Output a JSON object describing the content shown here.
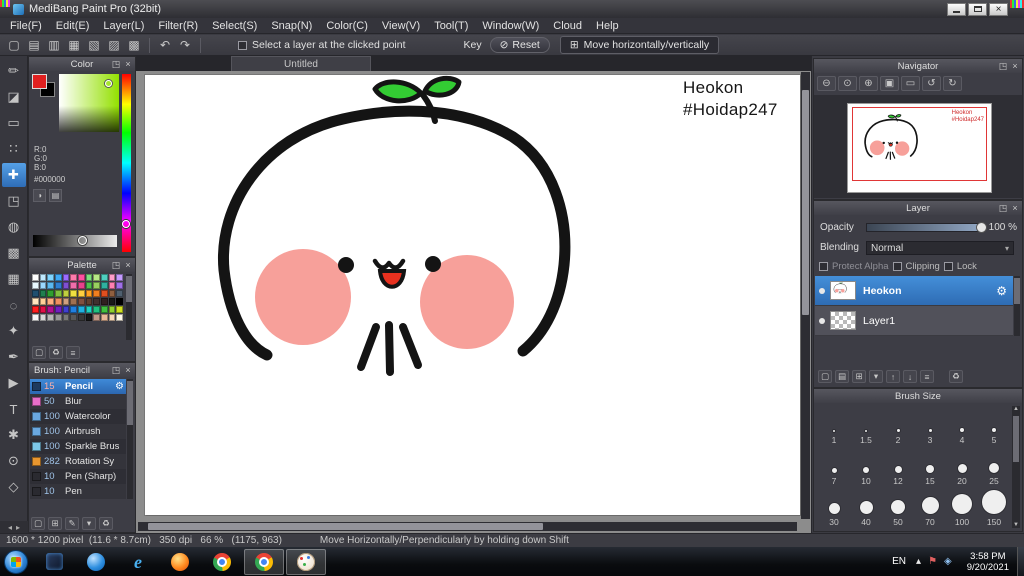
{
  "titlebar": {
    "title": "MediBang Paint Pro (32bit)"
  },
  "menubar": {
    "items": [
      "File(F)",
      "Edit(E)",
      "Layer(L)",
      "Filter(R)",
      "Select(S)",
      "Snap(N)",
      "Color(C)",
      "View(V)",
      "Tool(T)",
      "Window(W)",
      "Cloud",
      "Help"
    ]
  },
  "toolbar": {
    "file_icons": [
      {
        "name": "new-canvas-icon",
        "glyph": "▢"
      },
      {
        "name": "open-file-icon",
        "glyph": "▤"
      },
      {
        "name": "save-icon",
        "glyph": "▥"
      },
      {
        "name": "export-icon",
        "glyph": "▦"
      },
      {
        "name": "grid-toggle-icon",
        "glyph": "▧"
      },
      {
        "name": "guide-toggle-icon",
        "glyph": "▨"
      },
      {
        "name": "material-panel-icon",
        "glyph": "▩"
      }
    ],
    "undo_glyph": "↶",
    "redo_glyph": "↷",
    "checkbox_label": "Select a layer at the clicked point",
    "key_label": "Key",
    "reset_glyph": "⊘",
    "reset_label": "Reset",
    "move_glyph": "⊞",
    "move_label": "Move horizontally/vertically"
  },
  "tools": {
    "selected_index": 4,
    "items": [
      {
        "name": "pen-tool",
        "glyph": "✏"
      },
      {
        "name": "eraser-tool",
        "glyph": "◪"
      },
      {
        "name": "rect-select-tool",
        "glyph": "▭"
      },
      {
        "name": "pattern-tool",
        "glyph": "∷"
      },
      {
        "name": "move-tool",
        "glyph": "✚"
      },
      {
        "name": "transform-tool",
        "glyph": "◳"
      },
      {
        "name": "fill-tool",
        "glyph": "◍"
      },
      {
        "name": "gradient-tool",
        "glyph": "▩"
      },
      {
        "name": "select-tool",
        "glyph": "▦"
      },
      {
        "name": "lasso-tool",
        "glyph": "◌"
      },
      {
        "name": "magic-wand-tool",
        "glyph": "✦"
      },
      {
        "name": "draw-tool",
        "glyph": "✒"
      },
      {
        "name": "operation-tool",
        "glyph": "▶"
      },
      {
        "name": "text-tool",
        "glyph": "T"
      },
      {
        "name": "brush-tool",
        "glyph": "✱"
      },
      {
        "name": "eyedropper-tool",
        "glyph": "⊙"
      },
      {
        "name": "hand-tool",
        "glyph": "◇"
      }
    ]
  },
  "color_panel": {
    "title": "Color",
    "r": "R:0",
    "g": "G:0",
    "b": "B:0",
    "hex": "#000000",
    "foreground": "#e02020",
    "background": "#000000"
  },
  "palette_panel": {
    "title": "Palette",
    "colors": [
      "#ffffff",
      "#bfe9ff",
      "#7fd4ff",
      "#3fa9f5",
      "#9b6bff",
      "#ff7bac",
      "#ff4fa0",
      "#7ee07e",
      "#b8e986",
      "#4fd0c0",
      "#ff9ecb",
      "#c49bff",
      "#e8f8ff",
      "#9bd8ff",
      "#5bb8f0",
      "#2f7fd0",
      "#7f4fd0",
      "#f06eaa",
      "#e8428c",
      "#4fc04f",
      "#98d060",
      "#2fb0a0",
      "#ff7fb0",
      "#a070e8",
      "#1f4f6f",
      "#1f7f4f",
      "#2f9f2f",
      "#7fc040",
      "#c0d040",
      "#f0e040",
      "#ffd040",
      "#ffa020",
      "#f07f20",
      "#e04f20",
      "#8f5f3f",
      "#4f5f6f",
      "#ffe8c0",
      "#ffd098",
      "#ffb080",
      "#f09060",
      "#d0a080",
      "#a07050",
      "#805040",
      "#604030",
      "#40302f",
      "#302020",
      "#181818",
      "#000000",
      "#ff2020",
      "#e01048",
      "#b01090",
      "#7020c0",
      "#4040d0",
      "#2080e0",
      "#20b0e0",
      "#20d0c0",
      "#20c080",
      "#40c040",
      "#90d030",
      "#d0e020",
      "#f8f8f8",
      "#d8d8d8",
      "#b8b8b8",
      "#989898",
      "#787878",
      "#585858",
      "#383838",
      "#181818",
      "#c09888",
      "#e8b898",
      "#f8d8b8",
      "#fff8e8"
    ],
    "buttons": [
      {
        "name": "add-color-icon",
        "glyph": "▢"
      },
      {
        "name": "delete-color-icon",
        "glyph": "♻"
      },
      {
        "name": "palette-menu-icon",
        "glyph": "≡"
      }
    ]
  },
  "brush_panel": {
    "title": "Brush: Pencil",
    "brushes": [
      {
        "size": "15",
        "name": "Pencil",
        "swatch": "#1e3a5f",
        "selected": true
      },
      {
        "size": "50",
        "name": "Blur",
        "swatch": "#e86ec8",
        "selected": false
      },
      {
        "size": "100",
        "name": "Watercolor",
        "swatch": "#6aa8e0",
        "selected": false
      },
      {
        "size": "100",
        "name": "Airbrush",
        "swatch": "#6aa8e0",
        "selected": false
      },
      {
        "size": "100",
        "name": "Sparkle Brus",
        "swatch": "#7ec8e8",
        "selected": false
      },
      {
        "size": "282",
        "name": "Rotation Sy",
        "swatch": "#e8962f",
        "selected": false
      },
      {
        "size": "10",
        "name": "Pen (Sharp)",
        "swatch": "#2a2a30",
        "selected": false
      },
      {
        "size": "10",
        "name": "Pen",
        "swatch": "#2a2a30",
        "selected": false
      }
    ],
    "buttons": [
      {
        "name": "add-brush-icon",
        "glyph": "▢"
      },
      {
        "name": "duplicate-brush-icon",
        "glyph": "⊞"
      },
      {
        "name": "edit-brush-icon",
        "glyph": "✎"
      },
      {
        "name": "brush-menu-icon",
        "glyph": "▾"
      },
      {
        "name": "delete-brush-icon",
        "glyph": "♻"
      }
    ]
  },
  "canvas": {
    "tab_label": "Untitled",
    "annotation_line1": "Heokon",
    "annotation_line2": "#Hoidap247"
  },
  "navigator": {
    "title": "Navigator",
    "buttons": [
      {
        "name": "zoom-out-icon",
        "glyph": "⊖"
      },
      {
        "name": "zoom-reset-icon",
        "glyph": "⊙"
      },
      {
        "name": "zoom-in-icon",
        "glyph": "⊕"
      },
      {
        "name": "fit-window-icon",
        "glyph": "▣"
      },
      {
        "name": "actual-size-icon",
        "glyph": "▭"
      },
      {
        "name": "rotate-left-icon",
        "glyph": "↺"
      },
      {
        "name": "rotate-right-icon",
        "glyph": "↻"
      }
    ]
  },
  "layer_panel": {
    "title": "Layer",
    "opacity_label": "Opacity",
    "opacity_value": "100 %",
    "blending_label": "Blending",
    "blending_value": "Normal",
    "protect_alpha_label": "Protect Alpha",
    "clipping_label": "Clipping",
    "lock_label": "Lock",
    "layers": [
      {
        "name": "Heokon",
        "selected": true,
        "thumb": "art"
      },
      {
        "name": "Layer1",
        "selected": false,
        "thumb": "checker"
      }
    ],
    "buttons": [
      {
        "name": "add-layer-icon",
        "glyph": "▢"
      },
      {
        "name": "add-folder-icon",
        "glyph": "▤"
      },
      {
        "name": "duplicate-layer-icon",
        "glyph": "⊞"
      },
      {
        "name": "layer-menu-icon",
        "glyph": "▾"
      },
      {
        "name": "move-layer-up-icon",
        "glyph": "↑"
      },
      {
        "name": "move-layer-down-icon",
        "glyph": "↓"
      },
      {
        "name": "merge-layer-icon",
        "glyph": "≡"
      },
      {
        "name": "delete-layer-icon",
        "glyph": "♻"
      }
    ]
  },
  "brush_size_panel": {
    "title": "Brush Size",
    "sizes": [
      "1",
      "1.5",
      "2",
      "3",
      "4",
      "5",
      "7",
      "10",
      "12",
      "15",
      "20",
      "25",
      "30",
      "40",
      "50",
      "70",
      "100",
      "150"
    ]
  },
  "statusbar": {
    "info": "1600 * 1200 pixel  (11.6 * 8.7cm)   350 dpi   66 %   (1175, 963)",
    "hint": "Move Horizontally/Perpendicularly by holding down Shift"
  },
  "taskbar": {
    "apps": [
      {
        "name": "taskbar-app-media",
        "type": "dark",
        "active": false
      },
      {
        "name": "taskbar-app-messenger",
        "type": "msg",
        "active": false
      },
      {
        "name": "taskbar-app-internet-explorer",
        "type": "ie",
        "letter": "e",
        "active": false
      },
      {
        "name": "taskbar-app-firefox",
        "type": "firefox",
        "active": false
      },
      {
        "name": "taskbar-app-chrome",
        "type": "chrome",
        "active": false
      },
      {
        "name": "taskbar-app-chrome-2",
        "type": "chrome",
        "active": true
      },
      {
        "name": "taskbar-app-medibang",
        "type": "medibang",
        "active": true
      }
    ],
    "tray": [
      {
        "name": "tray-expand-icon",
        "glyph": "▴",
        "color": "#e8e8e8"
      },
      {
        "name": "tray-flag-icon",
        "glyph": "⚑",
        "color": "#e06060"
      },
      {
        "name": "tray-network-icon",
        "glyph": "◈",
        "color": "#8fc0f0"
      }
    ],
    "language": "EN",
    "time": "3:58 PM",
    "date": "9/20/2021"
  }
}
